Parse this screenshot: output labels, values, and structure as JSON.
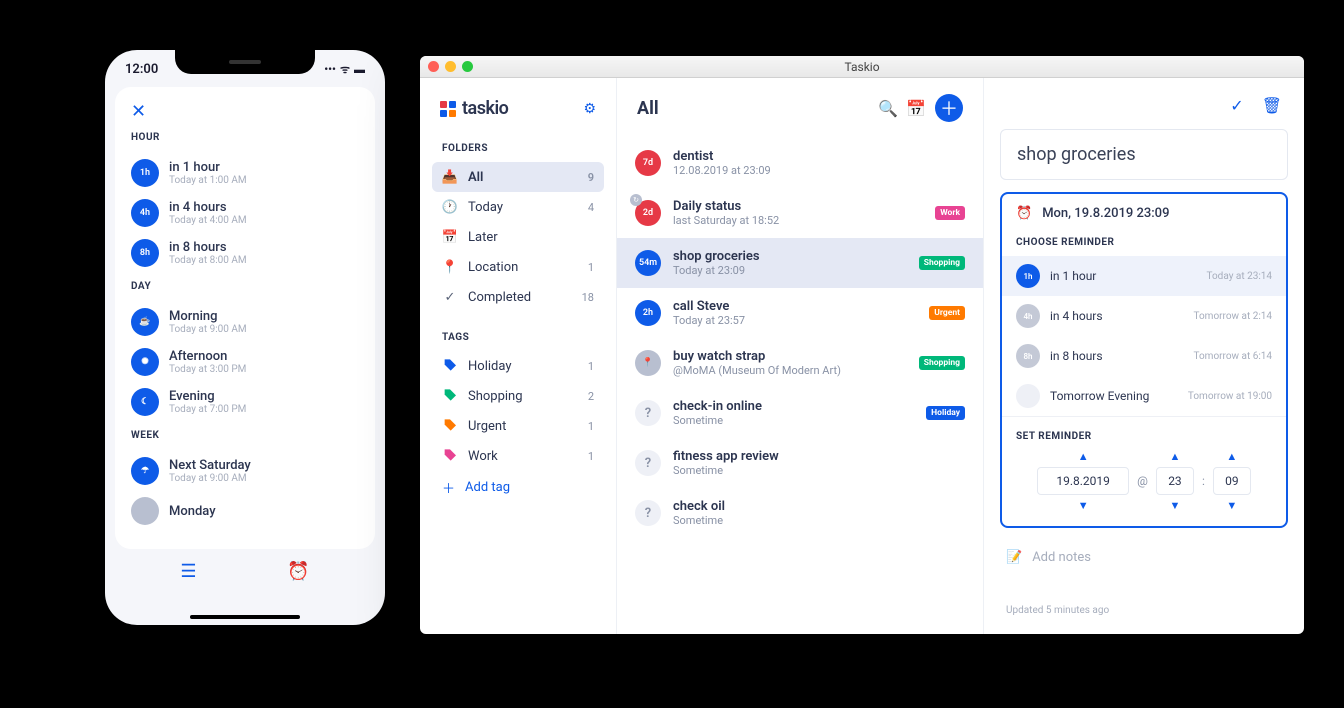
{
  "phone": {
    "time": "12:00",
    "sections": {
      "hour": {
        "label": "HOUR",
        "items": [
          {
            "badge": "1h",
            "title": "in 1 hour",
            "sub": "Today at 1:00 AM"
          },
          {
            "badge": "4h",
            "title": "in 4 hours",
            "sub": "Today at 4:00 AM"
          },
          {
            "badge": "8h",
            "title": "in 8 hours",
            "sub": "Today at 8:00 AM"
          }
        ]
      },
      "day": {
        "label": "DAY",
        "items": [
          {
            "badge": "☕",
            "title": "Morning",
            "sub": "Today at 9:00 AM"
          },
          {
            "badge": "✺",
            "title": "Afternoon",
            "sub": "Today at 3:00 PM"
          },
          {
            "badge": "☾",
            "title": "Evening",
            "sub": "Today at 7:00 PM"
          }
        ]
      },
      "week": {
        "label": "WEEK",
        "items": [
          {
            "badge": "☂",
            "title": "Next Saturday",
            "sub": "Today at 9:00 AM"
          },
          {
            "badge": "",
            "title": "Monday",
            "sub": ""
          }
        ]
      }
    }
  },
  "desktop": {
    "windowTitle": "Taskio",
    "appName": "taskio",
    "sidebar": {
      "foldersLabel": "FOLDERS",
      "folders": [
        {
          "name": "All",
          "count": "9",
          "active": true
        },
        {
          "name": "Today",
          "count": "4"
        },
        {
          "name": "Later",
          "count": ""
        },
        {
          "name": "Location",
          "count": "1"
        },
        {
          "name": "Completed",
          "count": "18"
        }
      ],
      "tagsLabel": "TAGS",
      "tags": [
        {
          "name": "Holiday",
          "count": "1",
          "color": "#0e5be8"
        },
        {
          "name": "Shopping",
          "count": "2",
          "color": "#00b87a"
        },
        {
          "name": "Urgent",
          "count": "1",
          "color": "#ff7a00"
        },
        {
          "name": "Work",
          "count": "1",
          "color": "#e84393"
        }
      ],
      "addTag": "Add tag"
    },
    "main": {
      "title": "All",
      "tasks": [
        {
          "circle": "7d",
          "ctype": "red",
          "title": "dentist",
          "sub": "12.08.2019 at 23:09",
          "badge": ""
        },
        {
          "circle": "2d",
          "ctype": "red",
          "title": "Daily status",
          "sub": "last Saturday at 18:52",
          "badge": "Work",
          "recur": true
        },
        {
          "circle": "54m",
          "ctype": "blue",
          "title": "shop groceries",
          "sub": "Today at 23:09",
          "badge": "Shopping",
          "selected": true
        },
        {
          "circle": "2h",
          "ctype": "blue",
          "title": "call Steve",
          "sub": "Today at 23:57",
          "badge": "Urgent"
        },
        {
          "circle": "📍",
          "ctype": "grey",
          "title": "buy watch strap",
          "sub": "@MoMA (Museum Of Modern Art)",
          "badge": "Shopping"
        },
        {
          "circle": "?",
          "ctype": "q",
          "title": "check-in online",
          "sub": "Sometime",
          "badge": "Holiday"
        },
        {
          "circle": "?",
          "ctype": "q",
          "title": "fitness app review",
          "sub": "Sometime",
          "badge": ""
        },
        {
          "circle": "?",
          "ctype": "q",
          "title": "check oil",
          "sub": "Sometime",
          "badge": ""
        }
      ]
    },
    "detail": {
      "title": "shop groceries",
      "reminderDate": "Mon, 19.8.2019 23:09",
      "chooseLabel": "CHOOSE REMINDER",
      "choices": [
        {
          "badge": "1h",
          "title": "in 1 hour",
          "sub": "Today at 23:14",
          "active": true
        },
        {
          "badge": "4h",
          "title": "in 4 hours",
          "sub": "Tomorrow at 2:14"
        },
        {
          "badge": "8h",
          "title": "in 8 hours",
          "sub": "Tomorrow at 6:14"
        },
        {
          "badge": "",
          "title": "Tomorrow Evening",
          "sub": "Tomorrow at 19:00"
        }
      ],
      "setLabel": "SET REMINDER",
      "dateValue": "19.8.2019",
      "atLabel": "@",
      "hourValue": "23",
      "minValue": "09",
      "colon": ":",
      "notesLabel": "Add notes",
      "updated": "Updated 5 minutes ago"
    }
  }
}
